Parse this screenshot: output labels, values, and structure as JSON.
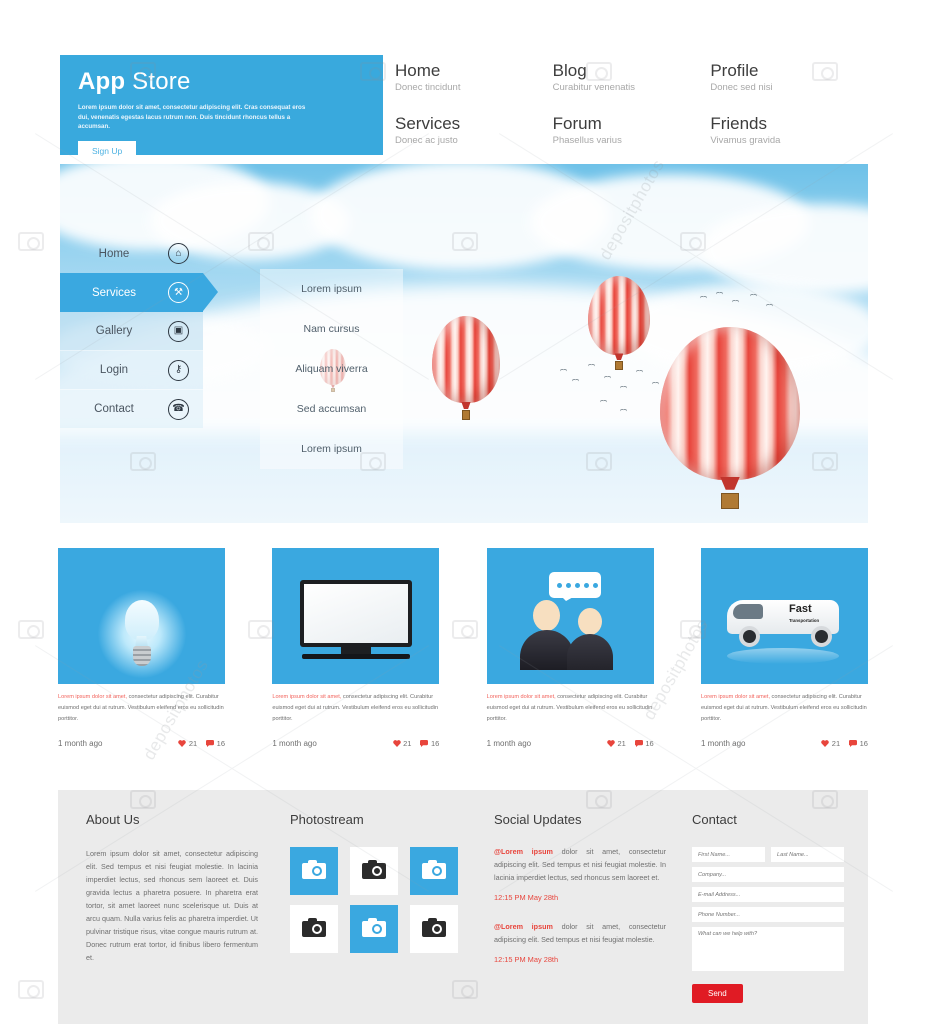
{
  "brand": {
    "name_bold": "App",
    "name_light": "Store",
    "description": "Lorem ipsum dolor sit amet, consectetur adipiscing elit. Cras consequat eros dui, venenatis egestas lacus rutrum non. Duis tincidunt rhoncus tellus a accumsan.",
    "signup_label": "Sign Up",
    "accent_color": "#39a9dd"
  },
  "topnav": [
    {
      "title": "Home",
      "subtitle": "Donec tincidunt"
    },
    {
      "title": "Blog",
      "subtitle": "Curabitur venenatis"
    },
    {
      "title": "Profile",
      "subtitle": "Donec sed nisi"
    },
    {
      "title": "Services",
      "subtitle": "Donec ac justo"
    },
    {
      "title": "Forum",
      "subtitle": "Phasellus varius"
    },
    {
      "title": "Friends",
      "subtitle": "Vivamus gravida"
    }
  ],
  "hero": {
    "sidebar": [
      {
        "label": "Home",
        "icon": "house-icon",
        "glyph": "⌂",
        "active": false
      },
      {
        "label": "Services",
        "icon": "tools-icon",
        "glyph": "⚒",
        "active": true
      },
      {
        "label": "Gallery",
        "icon": "camera-icon",
        "glyph": "▣",
        "active": false
      },
      {
        "label": "Login",
        "icon": "key-icon",
        "glyph": "⚷",
        "active": false
      },
      {
        "label": "Contact",
        "icon": "phone-icon",
        "glyph": "☎",
        "active": false
      }
    ],
    "submenu": [
      "Lorem ipsum",
      "Nam cursus",
      "Aliquam viverra",
      "Sed accumsan",
      "Lorem ipsum"
    ],
    "scene": "hot-air-balloons-in-clouds"
  },
  "cards": [
    {
      "image": "lightbulb-icon",
      "highlight": "Lorem ipsum dolor sit amet,",
      "text": " consectetur adipiscing elit. Curabitur euismod eget dui at rutrum. Vestibulum eleifend eros eu sollicitudin porttitor.",
      "time": "1 month ago",
      "likes": "21",
      "comments": "16"
    },
    {
      "image": "monitor-icon",
      "highlight": "Lorem ipsum dolor sit amet,",
      "text": " consectetur adipiscing elit. Curabitur euismod eget dui at rutrum. Vestibulum eleifend eros eu sollicitudin porttitor.",
      "time": "1 month ago",
      "likes": "21",
      "comments": "16"
    },
    {
      "image": "people-chat-icon",
      "highlight": "Lorem ipsum dolor sit amet,",
      "text": " consectetur adipiscing elit. Curabitur euismod eget dui at rutrum. Vestibulum eleifend eros eu sollicitudin porttitor.",
      "time": "1 month ago",
      "likes": "21",
      "comments": "16"
    },
    {
      "image": "delivery-van-icon",
      "van_text": "Fast",
      "van_subtext": "Transportation",
      "highlight": "Lorem ipsum dolor sit amet,",
      "text": " consectetur adipiscing elit. Curabitur euismod eget dui at rutrum. Vestibulum eleifend eros eu sollicitudin porttitor.",
      "time": "1 month ago",
      "likes": "21",
      "comments": "16"
    }
  ],
  "footer": {
    "about": {
      "heading": "About Us",
      "body": "Lorem ipsum dolor sit amet, consectetur adipiscing elit. Sed tempus et nisi feugiat molestie. In lacinia imperdiet lectus, sed rhoncus sem laoreet et. Duis gravida lectus a pharetra posuere. In pharetra erat tortor, sit amet laoreet nunc scelerisque ut. Duis at arcu quam. Nulla varius felis ac pharetra imperdiet. Ut pulvinar tristique risus, vitae congue mauris rutrum at. Donec rutrum erat tortor, id finibus libero fermentum et."
    },
    "photostream": {
      "heading": "Photostream",
      "thumbs": [
        "blue",
        "white",
        "blue",
        "white",
        "blue",
        "white"
      ]
    },
    "social": {
      "heading": "Social Updates",
      "posts": [
        {
          "handle": "@Lorem ipsum",
          "text": " dolor sit amet, consectetur adipiscing elit. Sed tempus et nisi feugiat molestie. In lacinia imperdiet lectus, sed rhoncus sem laoreet et.",
          "time": "12:15 PM May 28th"
        },
        {
          "handle": "@Lorem ipsum",
          "text": " dolor sit amet, consectetur adipiscing elit. Sed tempus et nisi feugiat molestie.",
          "time": "12:15 PM May 28th"
        }
      ]
    },
    "contact": {
      "heading": "Contact",
      "fields": {
        "first_name": "First Name...",
        "last_name": "Last Name...",
        "company": "Company...",
        "email": "E-mail Address...",
        "phone": "Phone Number...",
        "message": "What can we help with?"
      },
      "send_label": "Send",
      "send_color": "#e01b24"
    }
  }
}
